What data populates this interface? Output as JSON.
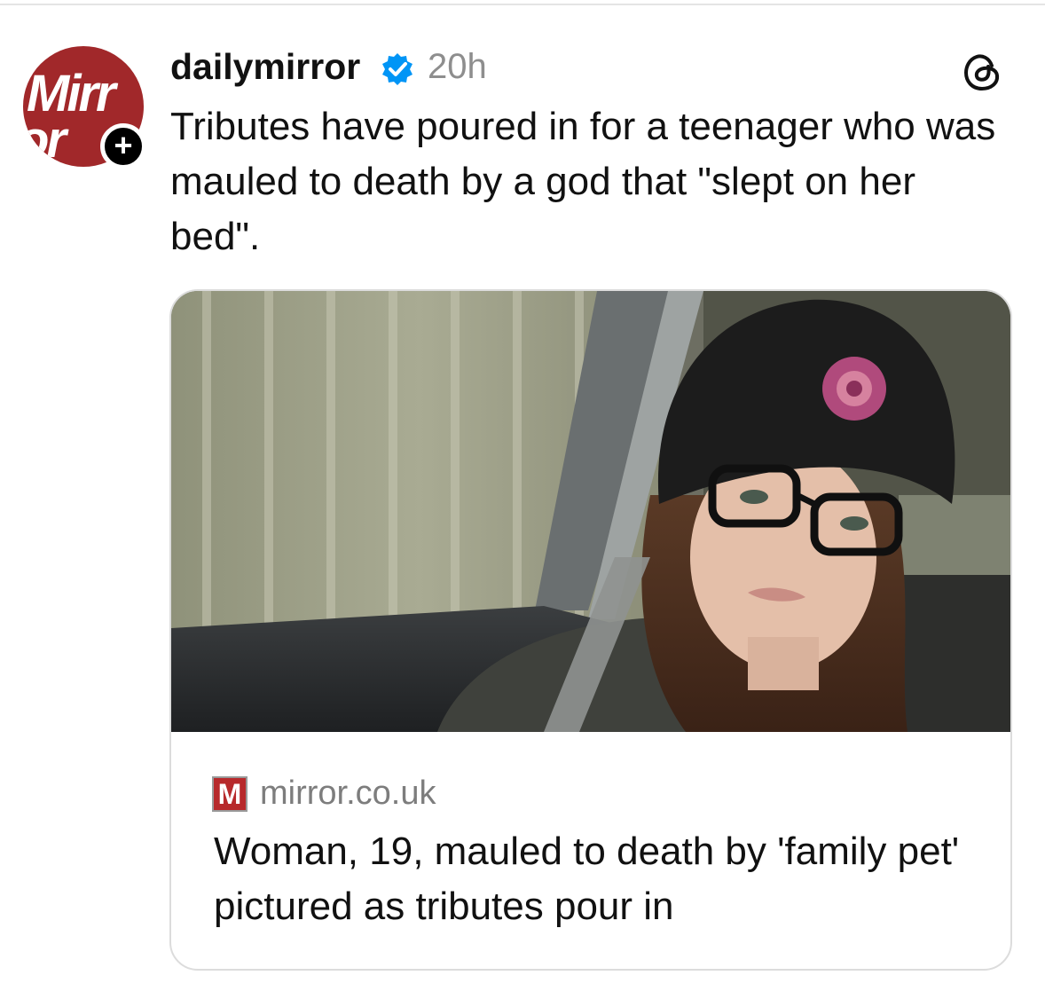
{
  "post": {
    "avatar_logo_line1": "Mirr",
    "avatar_logo_line2": "or",
    "follow_badge": "+",
    "username": "dailymirror",
    "timestamp": "20h",
    "text": "Tributes have poured in for a teenager who was mauled to death by a god that \"slept on her bed\".",
    "verified_icon": "verified-badge-icon",
    "app_icon": "threads-logo-icon"
  },
  "link_card": {
    "image_description_icon": "photo",
    "source_favicon": "M",
    "source_domain": "mirror.co.uk",
    "title": "Woman, 19, mauled to death by 'family pet' pictured as tributes pour in"
  },
  "colors": {
    "brand_red": "#a1282a",
    "verified_blue": "#0095f6",
    "muted_text": "#8e8e8e"
  }
}
